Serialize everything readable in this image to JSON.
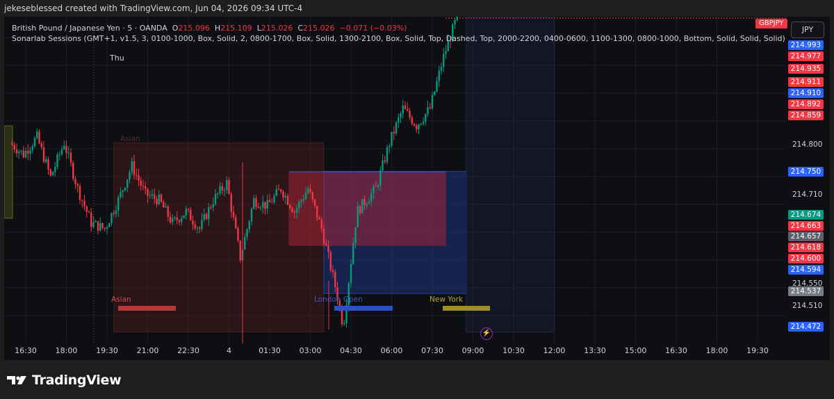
{
  "header": {
    "text": "jekeseblessed created with TradingView.com, Jun 04, 2026 09:34 UTC-4"
  },
  "legend": {
    "symbol_line": "British Pound / Japanese Yen · 5 · OANDA",
    "o_label": "O",
    "o_value": "215.096",
    "h_label": "H",
    "h_value": "215.109",
    "l_label": "L",
    "l_value": "215.026",
    "c_label": "C",
    "c_value": "215.026",
    "change": "−0.071 (−0.03%)",
    "indicator_line": "Sonarlab Sessions (GMT+1, v1.5, 3, 0100-1000, Box, Solid, 2, 0800-1700, Box, Solid, 1300-2100, Box, Solid, Top, Dashed, Top, 2000-2200, 0400-0600, 1100-1300, 0800-1000, Bottom, Solid, Solid, Solid)"
  },
  "symbol_badge": "GBPJPY",
  "currency_button": "JPY",
  "day_label": "Thu",
  "sessions": {
    "asian_box_label": "Asian",
    "asian": "Asian",
    "london": "London Open",
    "newyork": "New York"
  },
  "price_tags": [
    {
      "value": "214.993",
      "color": "#2962ff"
    },
    {
      "value": "214.977",
      "color": "#f23645"
    },
    {
      "value": "214.935",
      "color": "#f23645"
    },
    {
      "value": "214.911",
      "color": "#f23645"
    },
    {
      "value": "214.910",
      "color": "#2962ff"
    },
    {
      "value": "214.892",
      "color": "#f23645"
    },
    {
      "value": "214.859",
      "color": "#f23645"
    },
    {
      "value": "214.750",
      "color": "#2962ff"
    },
    {
      "value": "214.674",
      "color": "#089981"
    },
    {
      "value": "214.663",
      "color": "#f23645"
    },
    {
      "value": "214.657",
      "color": "#5d606b"
    },
    {
      "value": "214.618",
      "color": "#f23645"
    },
    {
      "value": "214.600",
      "color": "#f23645"
    },
    {
      "value": "214.594",
      "color": "#2962ff"
    },
    {
      "value": "214.537",
      "color": "#787b86"
    },
    {
      "value": "214.472",
      "color": "#2962ff"
    }
  ],
  "axis_prices": [
    "214.800",
    "214.710",
    "214.550",
    "214.510"
  ],
  "tv_brand": "TradingView",
  "chart_data": {
    "type": "candlestick",
    "instrument": "GBPJPY",
    "interval": "5",
    "x_ticks": [
      "16:30",
      "18:00",
      "19:30",
      "21:00",
      "22:30",
      "4",
      "01:30",
      "03:00",
      "04:30",
      "06:00",
      "07:30",
      "09:00",
      "10:30",
      "12:00",
      "13:30",
      "15:00",
      "16:30",
      "18:00",
      "19:30"
    ],
    "ohlc_last": {
      "open": 215.096,
      "high": 215.109,
      "low": 215.026,
      "close": 215.026
    },
    "ylim": [
      214.45,
      215.02
    ],
    "price_path": [
      [
        16.0,
        214.8
      ],
      [
        16.5,
        214.78
      ],
      [
        17.0,
        214.81
      ],
      [
        17.5,
        214.74
      ],
      [
        18.0,
        214.8
      ],
      [
        18.5,
        214.72
      ],
      [
        19.0,
        214.66
      ],
      [
        19.5,
        214.65
      ],
      [
        20.0,
        214.7
      ],
      [
        20.5,
        214.76
      ],
      [
        21.0,
        214.71
      ],
      [
        21.5,
        214.7
      ],
      [
        22.0,
        214.66
      ],
      [
        22.5,
        214.68
      ],
      [
        23.0,
        214.65
      ],
      [
        23.5,
        214.7
      ],
      [
        24.0,
        214.73
      ],
      [
        24.5,
        214.6
      ],
      [
        25.0,
        214.7
      ],
      [
        25.5,
        214.69
      ],
      [
        26.0,
        214.72
      ],
      [
        26.5,
        214.68
      ],
      [
        27.0,
        214.72
      ],
      [
        27.5,
        214.65
      ],
      [
        28.0,
        214.55
      ],
      [
        28.3,
        214.48
      ],
      [
        28.8,
        214.68
      ],
      [
        29.5,
        214.72
      ],
      [
        30.0,
        214.8
      ],
      [
        30.5,
        214.86
      ],
      [
        31.0,
        214.83
      ],
      [
        31.5,
        214.86
      ],
      [
        32.0,
        214.95
      ],
      [
        32.5,
        215.02
      ]
    ],
    "sessions": [
      {
        "name": "Asian",
        "start": "19:45",
        "end": "03:30",
        "low": 214.47,
        "high": 214.8
      },
      {
        "name": "London Open",
        "start": "03:30",
        "end": "08:45",
        "low": 214.537,
        "high": 214.75
      },
      {
        "name": "New York",
        "start": "08:45",
        "end": "12:00",
        "low": 214.47,
        "high": 215.02
      }
    ]
  }
}
